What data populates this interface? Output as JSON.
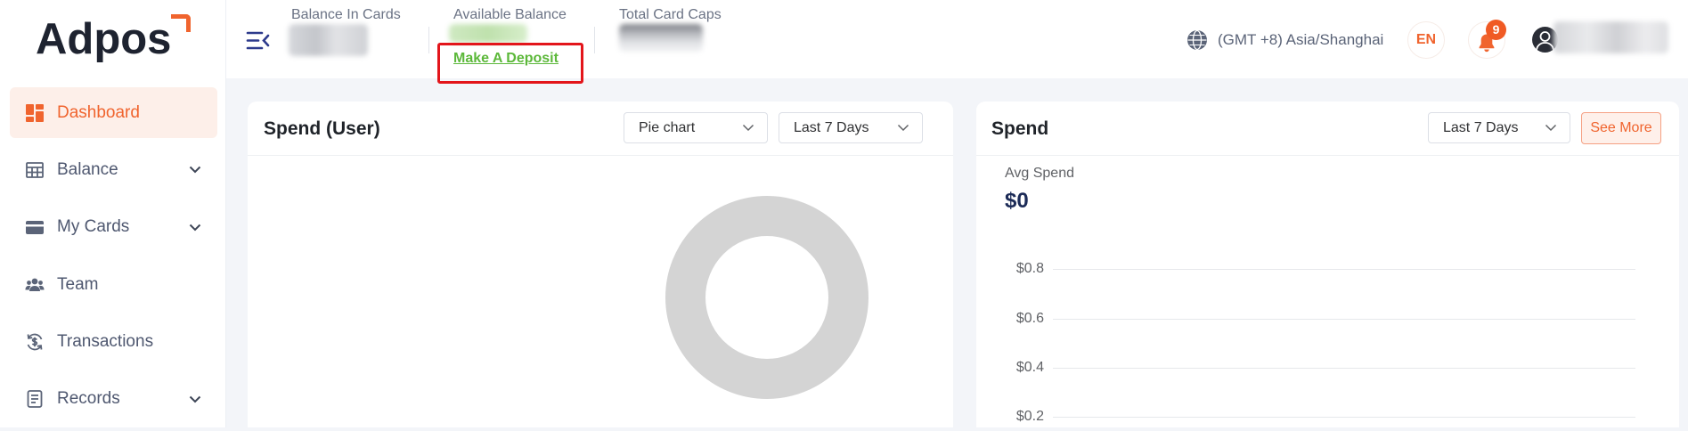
{
  "app": {
    "logo_text": "Adpos"
  },
  "colors": {
    "accent": "#f0642e",
    "active_nav_bg": "#fdefe9",
    "deposit_link": "#5cb83a",
    "highlight_box": "#e3151b",
    "notification_badge": "#f05a24",
    "avg_value": "#1c2b57",
    "donut_empty": "#d4d4d4"
  },
  "sidebar": {
    "items": [
      {
        "label": "Dashboard",
        "icon": "dashboard-icon",
        "active": true,
        "expandable": false
      },
      {
        "label": "Balance",
        "icon": "table-icon",
        "active": false,
        "expandable": true
      },
      {
        "label": "My Cards",
        "icon": "card-icon",
        "active": false,
        "expandable": true
      },
      {
        "label": "Team",
        "icon": "team-icon",
        "active": false,
        "expandable": false
      },
      {
        "label": "Transactions",
        "icon": "transactions-icon",
        "active": false,
        "expandable": false
      },
      {
        "label": "Records",
        "icon": "records-icon",
        "active": false,
        "expandable": true
      }
    ]
  },
  "header": {
    "menu_icon": "menu-collapse-icon",
    "stats": [
      {
        "label": "Balance In Cards"
      },
      {
        "label": "Available Balance",
        "action": "Make A Deposit"
      },
      {
        "label": "Total Card Caps"
      }
    ],
    "timezone": "(GMT +8) Asia/Shanghai",
    "language": "EN",
    "notifications_count": "9"
  },
  "spend_user_card": {
    "title": "Spend (User)",
    "chart_type_select": "Pie chart",
    "range_select": "Last 7 Days"
  },
  "spend_card": {
    "title": "Spend",
    "range_select": "Last 7 Days",
    "see_more": "See More",
    "avg_label": "Avg Spend",
    "avg_value": "$0",
    "y_ticks": [
      "$0.8",
      "$0.6",
      "$0.4",
      "$0.2"
    ]
  }
}
